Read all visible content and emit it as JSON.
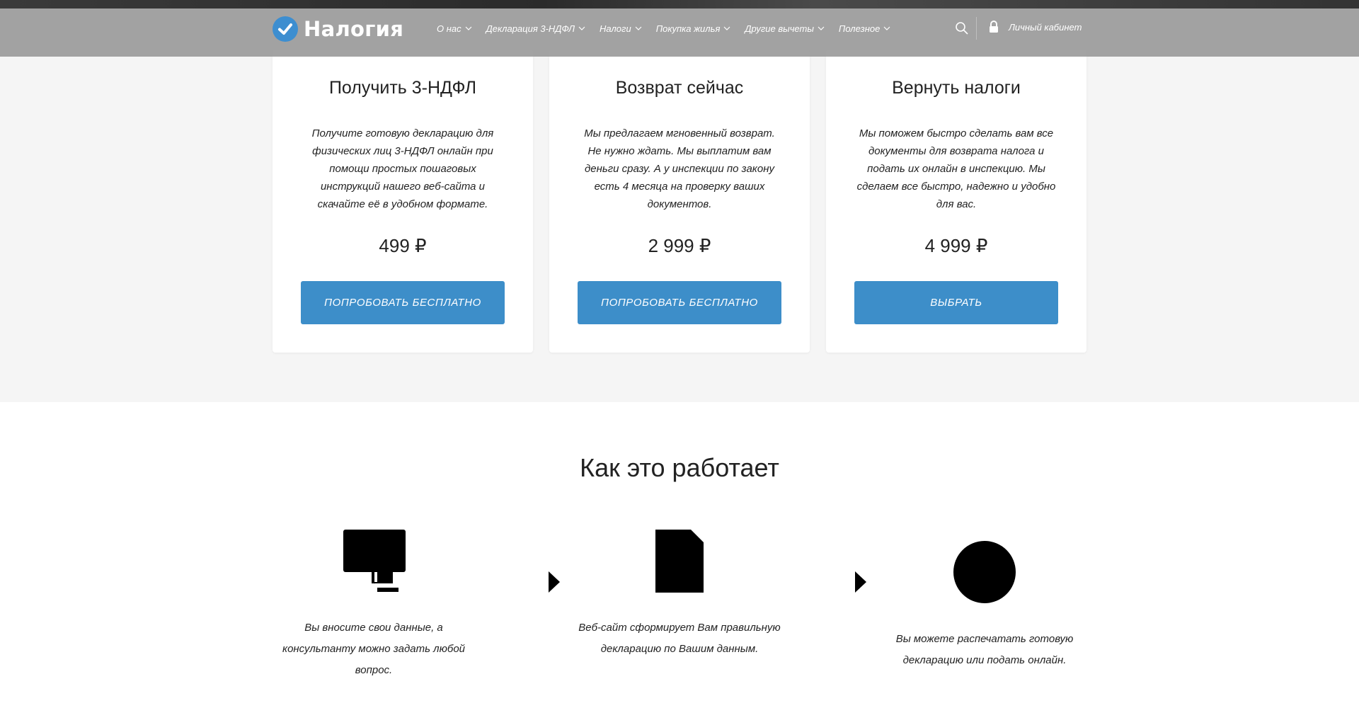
{
  "header": {
    "logo_text": "Налогия",
    "nav": [
      {
        "label": "О нас"
      },
      {
        "label": "Декларация 3-НДФЛ"
      },
      {
        "label": "Налоги"
      },
      {
        "label": "Покупка жилья"
      },
      {
        "label": "Другие вычеты"
      },
      {
        "label": "Полезное"
      }
    ],
    "cabinet_label": "Личный кабинет"
  },
  "colors": {
    "brand_blue": "#3d8ec9",
    "header_bg": "#969696",
    "section_bg": "#f5f5f5"
  },
  "pricing": [
    {
      "title": "Получить 3-НДФЛ",
      "description": "Получите готовую декларацию для физических лиц 3-НДФЛ онлайн при помощи простых пошаговых инструкций нашего веб-сайта и скачайте её в удобном формате.",
      "price": "499 ₽",
      "button": "ПОПРОБОВАТЬ БЕСПЛАТНО"
    },
    {
      "title": "Возврат сейчас",
      "description": "Мы предлагаем мгновенный возврат. Не нужно ждать. Мы выплатим вам деньги сразу. А у инспекции по закону есть 4 месяца на проверку ваших документов.",
      "price": "2 999 ₽",
      "button": "ПОПРОБОВАТЬ БЕСПЛАТНО"
    },
    {
      "title": "Вернуть налоги",
      "description": "Мы поможем быстро сделать вам все документы для возврата налога и подать их онлайн в инспекцию. Мы сделаем все быстро, надежно и удобно для вас.",
      "price": "4 999 ₽",
      "button": "ВЫБРАТЬ"
    }
  ],
  "how_it_works": {
    "title": "Как это работает",
    "steps": [
      {
        "icon": "computer-icon",
        "text": "Вы вносите свои данные, а консультанту можно задать любой вопрос."
      },
      {
        "icon": "document-icon",
        "text": "Веб-сайт сформирует Вам правильную декларацию по Вашим данным."
      },
      {
        "icon": "circle-icon",
        "text": "Вы можете распечатать готовую декларацию или подать онлайн."
      }
    ]
  }
}
